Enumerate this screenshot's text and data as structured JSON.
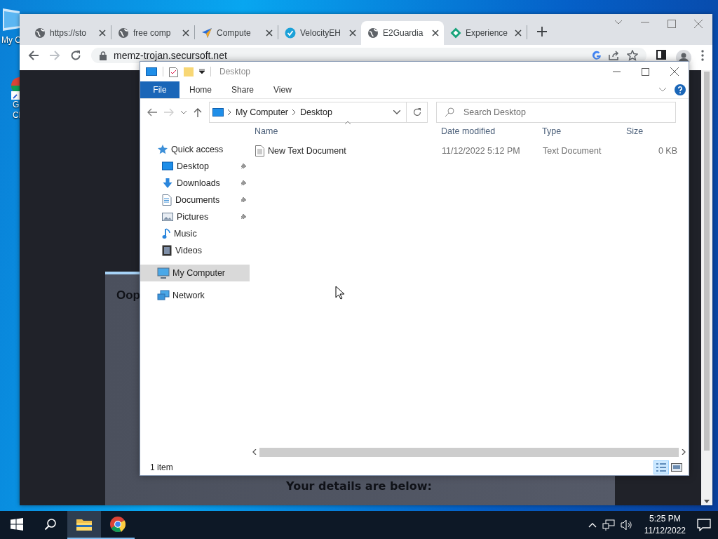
{
  "desktop": {
    "icons": [
      {
        "kind": "computer",
        "lines": [
          "My C"
        ]
      },
      {
        "kind": "chrome",
        "lines": [
          "G",
          "Cl"
        ]
      }
    ]
  },
  "browser": {
    "tabs": [
      {
        "title": "https://sto",
        "kind": "globe",
        "selected": false
      },
      {
        "title": "free comp",
        "kind": "globe",
        "selected": false
      },
      {
        "title": "Compute",
        "kind": "plane",
        "selected": false
      },
      {
        "title": "VelocityEH",
        "kind": "check",
        "selected": false
      },
      {
        "title": "E2Guardia",
        "kind": "globe",
        "selected": true
      },
      {
        "title": "Experience",
        "kind": "diamond",
        "selected": false
      }
    ],
    "address": "memz-trojan.secursoft.net",
    "page": {
      "heading": "Oop",
      "subheading": "Your details are below:"
    }
  },
  "explorer": {
    "title": "Desktop",
    "file_menu": "File",
    "ribbon_tabs": [
      "Home",
      "Share",
      "View"
    ],
    "breadcrumb": [
      "My Computer",
      "Desktop"
    ],
    "search_placeholder": "Search Desktop",
    "columns": [
      "Name",
      "Date modified",
      "Type",
      "Size"
    ],
    "rows": [
      {
        "name": "New Text Document",
        "date_modified": "11/12/2022 5:12 PM",
        "type": "Text Document",
        "size": "0 KB"
      }
    ],
    "nav": [
      {
        "label": "Quick access",
        "kind": "star",
        "selected": false,
        "children": [
          {
            "label": "Desktop",
            "kind": "desktop",
            "pinned": true,
            "selected": false
          },
          {
            "label": "Downloads",
            "kind": "download",
            "pinned": true,
            "selected": false
          },
          {
            "label": "Documents",
            "kind": "document",
            "pinned": true,
            "selected": false
          },
          {
            "label": "Pictures",
            "kind": "picture",
            "pinned": true,
            "selected": false
          },
          {
            "label": "Music",
            "kind": "music",
            "pinned": false,
            "selected": false
          },
          {
            "label": "Videos",
            "kind": "video",
            "pinned": false,
            "selected": false
          }
        ]
      },
      {
        "label": "My Computer",
        "kind": "computer",
        "selected": true
      },
      {
        "label": "Network",
        "kind": "network",
        "selected": false
      }
    ],
    "status": "1 item",
    "views": [
      {
        "kind": "details",
        "selected": true
      },
      {
        "kind": "large",
        "selected": false
      }
    ]
  },
  "taskbar": {
    "items": [
      {
        "kind": "start",
        "active": false,
        "running": false
      },
      {
        "kind": "search",
        "active": false,
        "running": false
      },
      {
        "kind": "explorer",
        "active": true,
        "running": true
      },
      {
        "kind": "chrome",
        "active": false,
        "running": true
      }
    ],
    "time": "5:25 PM",
    "date": "11/12/2022"
  }
}
